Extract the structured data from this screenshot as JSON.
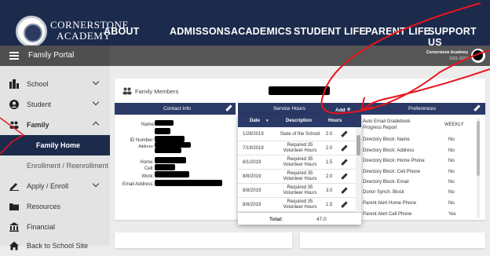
{
  "brand": {
    "line1": "CORNERSTONE",
    "line2": "ACADEMY"
  },
  "nav": [
    "ABOUT",
    "ADMISSONS",
    "ACADEMICS",
    "STUDENT LIFE",
    "PARENT LIFE",
    "SUPPORT US"
  ],
  "portal": {
    "title": "Family Portal",
    "school_name": "Cornerstone Academy",
    "school_year": "2021-2022"
  },
  "sidebar": {
    "items": [
      {
        "label": "School",
        "icon": "school-icon",
        "chevron": "down"
      },
      {
        "label": "Student",
        "icon": "student-icon",
        "chevron": "down"
      },
      {
        "label": "Family",
        "icon": "family-icon",
        "chevron": "up"
      },
      {
        "label": "Family Home"
      },
      {
        "label": "Enrollment / Reenrollment"
      },
      {
        "label": "Apply / Enroll",
        "icon": "edit-icon",
        "chevron": "down"
      },
      {
        "label": "Resources",
        "icon": "folder-icon"
      },
      {
        "label": "Financial",
        "icon": "bank-icon"
      },
      {
        "label": "Back to School Site",
        "icon": "home-icon"
      }
    ]
  },
  "family_members": {
    "title": "Family Members",
    "contact_header": "Contact Info",
    "field_labels": {
      "name": "Name:",
      "id_number": "ID Number:",
      "address": "Address:",
      "home": "Home:",
      "cell": "Cell:",
      "work": "Work:",
      "email": "Email Address:"
    }
  },
  "hours": {
    "header": "Service Hours",
    "add_label": "Add",
    "columns": [
      "Date",
      "Description",
      "Hours"
    ],
    "rows": [
      {
        "date": "1/28/2019",
        "description": "State of the School",
        "hours": "2.0"
      },
      {
        "date": "7/19/2019",
        "description": "Required 35 Volunteer Hours",
        "hours": "2.0"
      },
      {
        "date": "8/1/2019",
        "description": "Required 35 Volunteer Hours",
        "hours": "1.5"
      },
      {
        "date": "8/8/2019",
        "description": "Required 35 Volunteer Hours",
        "hours": "2.0"
      },
      {
        "date": "8/8/2019",
        "description": "Required 35 Volunteer Hours",
        "hours": "3.0"
      },
      {
        "date": "8/8/2019",
        "description": "Required 35 Volunteer Hours",
        "hours": "1.5"
      }
    ],
    "total_label": "Total:",
    "total_value": "47.0"
  },
  "preferences": {
    "header": "Preferences",
    "rows": [
      {
        "label": "Auto Email Gradebook Progress Report",
        "value": "WEEKLY"
      },
      {
        "label": "Directory Block: Name",
        "value": "No"
      },
      {
        "label": "Directory Block: Address",
        "value": "No"
      },
      {
        "label": "Directory Block: Home Phone",
        "value": "No"
      },
      {
        "label": "Directory Block: Cell Phone",
        "value": "No"
      },
      {
        "label": "Directory Block: Email",
        "value": "No"
      },
      {
        "label": "Donor Synch. Block",
        "value": "No"
      },
      {
        "label": "Parent Alert Home Phone",
        "value": "No"
      },
      {
        "label": "Parent Alert Cell Phone",
        "value": "Yes"
      }
    ]
  },
  "colors": {
    "navy": "#1c2b4c",
    "header_blue": "#2b3966",
    "active_item": "#1c2b4c",
    "annotation_red": "#e8141c"
  }
}
